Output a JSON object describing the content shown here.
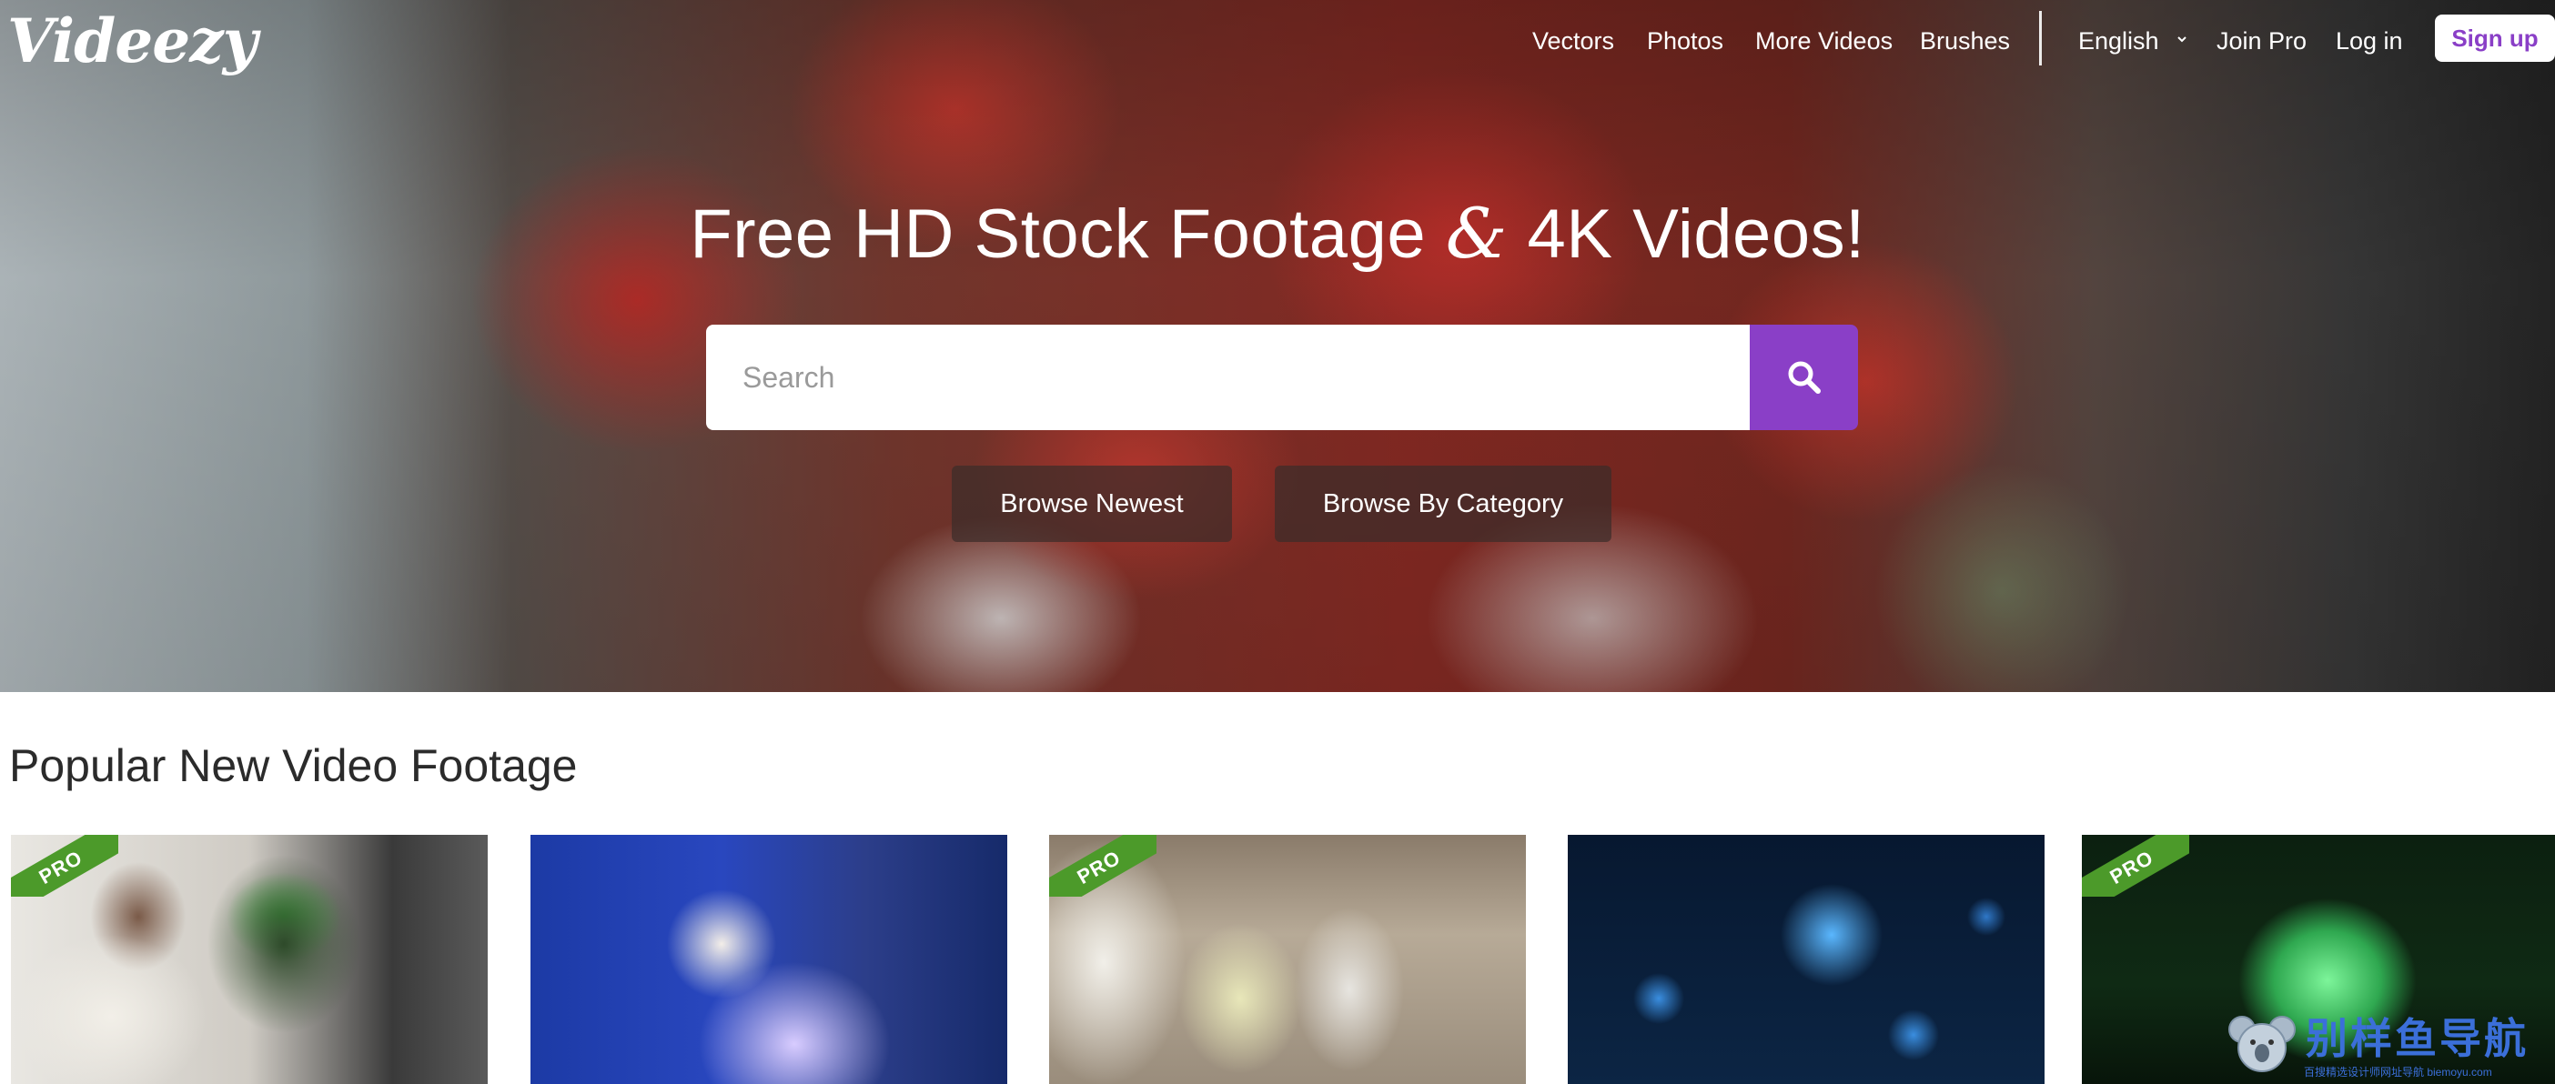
{
  "brand": {
    "logo_text": "Videezy",
    "accent_color": "#8a3fc7",
    "pro_color": "#4c9a2a"
  },
  "nav": {
    "links": [
      "Vectors",
      "Photos",
      "More Videos",
      "Brushes"
    ],
    "language": "English",
    "join_pro": "Join Pro",
    "log_in": "Log in",
    "sign_up": "Sign up"
  },
  "hero": {
    "headline_part1": "Free HD Stock Footage",
    "headline_amp": "&",
    "headline_part2": "4K Videos!",
    "search_placeholder": "Search",
    "browse_newest": "Browse Newest",
    "browse_category": "Browse By Category"
  },
  "section": {
    "title": "Popular New Video Footage",
    "pro_label": "PRO",
    "thumbnails": [
      {
        "pro": true
      },
      {
        "pro": false
      },
      {
        "pro": true
      },
      {
        "pro": false
      },
      {
        "pro": true
      }
    ]
  },
  "watermark": {
    "text": "别样鱼导航",
    "sub": "百搜精选设计师网址导航 biemoyu.com"
  }
}
